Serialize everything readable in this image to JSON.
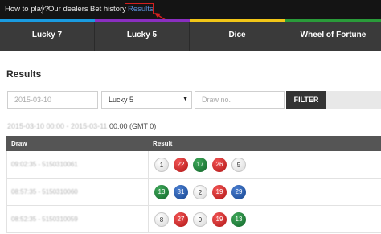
{
  "topnav": {
    "how_to_play": "How to play?",
    "our_dealers": "Our dealers",
    "bet_history": "Bet history",
    "results": "Results"
  },
  "colors": {
    "bar1": "#1a9be0",
    "bar2": "#8a2fc0",
    "bar3": "#f2c618",
    "bar4": "#2a9b3a",
    "results_highlight": "#d21f1f"
  },
  "game_tabs": [
    "Lucky 7",
    "Lucky 5",
    "Dice",
    "Wheel of Fortune"
  ],
  "page_title": "Results",
  "filter": {
    "date_value": "2015-03-10",
    "game_selected": "Lucky 5",
    "draw_placeholder": "Draw no.",
    "button_label": "FILTER"
  },
  "range": {
    "dates": "2015-03-10 00:00 - 2015-03-11",
    "time_zone": " 00:00 (GMT 0)"
  },
  "table": {
    "headers": [
      "Draw",
      "Result"
    ],
    "rows": [
      {
        "draw": "09:02:35 - 5150310061",
        "balls": [
          {
            "n": "1",
            "c": "white"
          },
          {
            "n": "22",
            "c": "red"
          },
          {
            "n": "17",
            "c": "green"
          },
          {
            "n": "26",
            "c": "red"
          },
          {
            "n": "5",
            "c": "white"
          }
        ]
      },
      {
        "draw": "08:57:35 - 5150310060",
        "balls": [
          {
            "n": "13",
            "c": "green"
          },
          {
            "n": "31",
            "c": "blue"
          },
          {
            "n": "2",
            "c": "white"
          },
          {
            "n": "19",
            "c": "red"
          },
          {
            "n": "29",
            "c": "blue"
          }
        ]
      },
      {
        "draw": "08:52:35 - 5150310059",
        "balls": [
          {
            "n": "8",
            "c": "white"
          },
          {
            "n": "27",
            "c": "red"
          },
          {
            "n": "9",
            "c": "white"
          },
          {
            "n": "19",
            "c": "red"
          },
          {
            "n": "13",
            "c": "green"
          }
        ]
      }
    ]
  }
}
